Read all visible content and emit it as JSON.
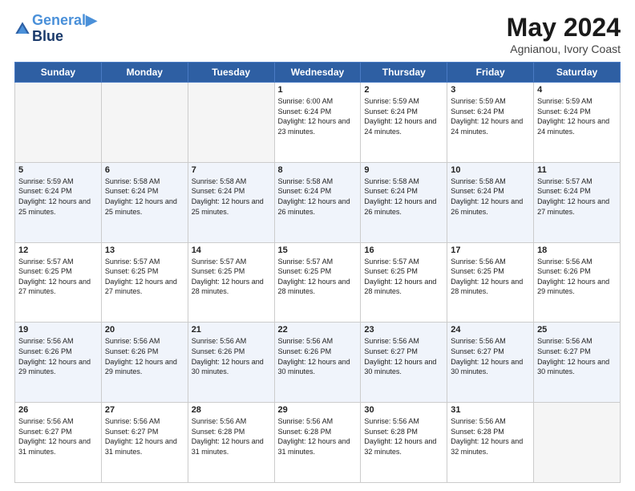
{
  "logo": {
    "line1": "General",
    "line2": "Blue"
  },
  "title": {
    "month_year": "May 2024",
    "location": "Agnianou, Ivory Coast"
  },
  "weekdays": [
    "Sunday",
    "Monday",
    "Tuesday",
    "Wednesday",
    "Thursday",
    "Friday",
    "Saturday"
  ],
  "weeks": [
    [
      {
        "day": "",
        "info": ""
      },
      {
        "day": "",
        "info": ""
      },
      {
        "day": "",
        "info": ""
      },
      {
        "day": "1",
        "info": "Sunrise: 6:00 AM\nSunset: 6:24 PM\nDaylight: 12 hours\nand 23 minutes."
      },
      {
        "day": "2",
        "info": "Sunrise: 5:59 AM\nSunset: 6:24 PM\nDaylight: 12 hours\nand 24 minutes."
      },
      {
        "day": "3",
        "info": "Sunrise: 5:59 AM\nSunset: 6:24 PM\nDaylight: 12 hours\nand 24 minutes."
      },
      {
        "day": "4",
        "info": "Sunrise: 5:59 AM\nSunset: 6:24 PM\nDaylight: 12 hours\nand 24 minutes."
      }
    ],
    [
      {
        "day": "5",
        "info": "Sunrise: 5:59 AM\nSunset: 6:24 PM\nDaylight: 12 hours\nand 25 minutes."
      },
      {
        "day": "6",
        "info": "Sunrise: 5:58 AM\nSunset: 6:24 PM\nDaylight: 12 hours\nand 25 minutes."
      },
      {
        "day": "7",
        "info": "Sunrise: 5:58 AM\nSunset: 6:24 PM\nDaylight: 12 hours\nand 25 minutes."
      },
      {
        "day": "8",
        "info": "Sunrise: 5:58 AM\nSunset: 6:24 PM\nDaylight: 12 hours\nand 26 minutes."
      },
      {
        "day": "9",
        "info": "Sunrise: 5:58 AM\nSunset: 6:24 PM\nDaylight: 12 hours\nand 26 minutes."
      },
      {
        "day": "10",
        "info": "Sunrise: 5:58 AM\nSunset: 6:24 PM\nDaylight: 12 hours\nand 26 minutes."
      },
      {
        "day": "11",
        "info": "Sunrise: 5:57 AM\nSunset: 6:24 PM\nDaylight: 12 hours\nand 27 minutes."
      }
    ],
    [
      {
        "day": "12",
        "info": "Sunrise: 5:57 AM\nSunset: 6:25 PM\nDaylight: 12 hours\nand 27 minutes."
      },
      {
        "day": "13",
        "info": "Sunrise: 5:57 AM\nSunset: 6:25 PM\nDaylight: 12 hours\nand 27 minutes."
      },
      {
        "day": "14",
        "info": "Sunrise: 5:57 AM\nSunset: 6:25 PM\nDaylight: 12 hours\nand 28 minutes."
      },
      {
        "day": "15",
        "info": "Sunrise: 5:57 AM\nSunset: 6:25 PM\nDaylight: 12 hours\nand 28 minutes."
      },
      {
        "day": "16",
        "info": "Sunrise: 5:57 AM\nSunset: 6:25 PM\nDaylight: 12 hours\nand 28 minutes."
      },
      {
        "day": "17",
        "info": "Sunrise: 5:56 AM\nSunset: 6:25 PM\nDaylight: 12 hours\nand 28 minutes."
      },
      {
        "day": "18",
        "info": "Sunrise: 5:56 AM\nSunset: 6:26 PM\nDaylight: 12 hours\nand 29 minutes."
      }
    ],
    [
      {
        "day": "19",
        "info": "Sunrise: 5:56 AM\nSunset: 6:26 PM\nDaylight: 12 hours\nand 29 minutes."
      },
      {
        "day": "20",
        "info": "Sunrise: 5:56 AM\nSunset: 6:26 PM\nDaylight: 12 hours\nand 29 minutes."
      },
      {
        "day": "21",
        "info": "Sunrise: 5:56 AM\nSunset: 6:26 PM\nDaylight: 12 hours\nand 30 minutes."
      },
      {
        "day": "22",
        "info": "Sunrise: 5:56 AM\nSunset: 6:26 PM\nDaylight: 12 hours\nand 30 minutes."
      },
      {
        "day": "23",
        "info": "Sunrise: 5:56 AM\nSunset: 6:27 PM\nDaylight: 12 hours\nand 30 minutes."
      },
      {
        "day": "24",
        "info": "Sunrise: 5:56 AM\nSunset: 6:27 PM\nDaylight: 12 hours\nand 30 minutes."
      },
      {
        "day": "25",
        "info": "Sunrise: 5:56 AM\nSunset: 6:27 PM\nDaylight: 12 hours\nand 30 minutes."
      }
    ],
    [
      {
        "day": "26",
        "info": "Sunrise: 5:56 AM\nSunset: 6:27 PM\nDaylight: 12 hours\nand 31 minutes."
      },
      {
        "day": "27",
        "info": "Sunrise: 5:56 AM\nSunset: 6:27 PM\nDaylight: 12 hours\nand 31 minutes."
      },
      {
        "day": "28",
        "info": "Sunrise: 5:56 AM\nSunset: 6:28 PM\nDaylight: 12 hours\nand 31 minutes."
      },
      {
        "day": "29",
        "info": "Sunrise: 5:56 AM\nSunset: 6:28 PM\nDaylight: 12 hours\nand 31 minutes."
      },
      {
        "day": "30",
        "info": "Sunrise: 5:56 AM\nSunset: 6:28 PM\nDaylight: 12 hours\nand 32 minutes."
      },
      {
        "day": "31",
        "info": "Sunrise: 5:56 AM\nSunset: 6:28 PM\nDaylight: 12 hours\nand 32 minutes."
      },
      {
        "day": "",
        "info": ""
      }
    ]
  ]
}
